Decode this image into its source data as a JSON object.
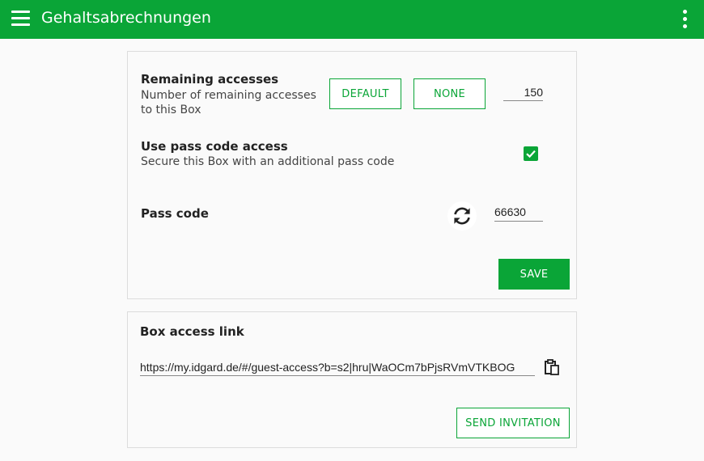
{
  "app": {
    "title": "Gehaltsabrechnungen"
  },
  "remaining": {
    "title": "Remaining accesses",
    "description": "Number of remaining accesses to this Box",
    "default_label": "DEFAULT",
    "none_label": "NONE",
    "value": "150"
  },
  "passcode_access": {
    "title": "Use pass code access",
    "description": "Secure this Box with an additional pass code",
    "checked": true
  },
  "passcode": {
    "title": "Pass code",
    "value": "66630"
  },
  "save_label": "SAVE",
  "link": {
    "title": "Box access link",
    "url": "https://my.idgard.de/#/guest-access?b=s2|hru|WaOCm7bPjsRVmVTKBOG",
    "send_label": "SEND INVITATION"
  },
  "icons": {
    "menu": "menu-icon",
    "more": "more-vert-icon",
    "check": "check-icon",
    "refresh": "refresh-icon",
    "clipboard": "clipboard-icon"
  },
  "colors": {
    "accent": "#0aa537",
    "background": "#fafafa",
    "border": "#dcdcdc"
  }
}
